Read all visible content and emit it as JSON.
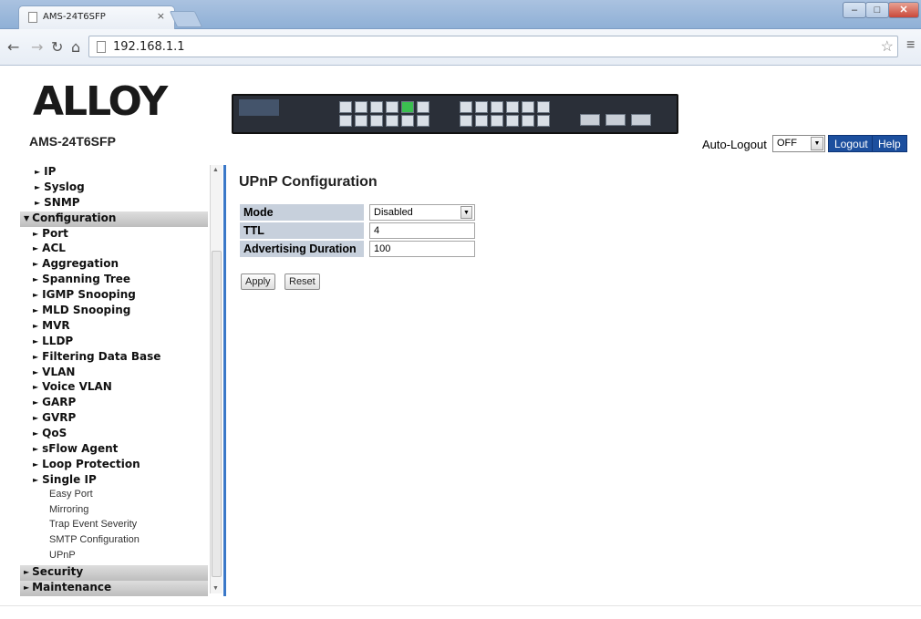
{
  "browser": {
    "tab_title": "AMS-24T6SFP",
    "tab_close": "×",
    "url": "192.168.1.1"
  },
  "header": {
    "logo_text": "ALLOY",
    "model": "AMS-24T6SFP",
    "switch_badge": "ALLOY",
    "auto_logout_label": "Auto-Logout",
    "auto_logout_value": "OFF",
    "logout_label": "Logout",
    "help_label": "Help"
  },
  "nav": {
    "items": [
      {
        "label": "IP",
        "level": "l1"
      },
      {
        "label": "Syslog",
        "level": "l1"
      },
      {
        "label": "SNMP",
        "level": "l1"
      },
      {
        "label": "Configuration",
        "level": "section",
        "expanded": true
      },
      {
        "label": "Port",
        "level": "l2"
      },
      {
        "label": "ACL",
        "level": "l2"
      },
      {
        "label": "Aggregation",
        "level": "l2"
      },
      {
        "label": "Spanning Tree",
        "level": "l2"
      },
      {
        "label": "IGMP Snooping",
        "level": "l2"
      },
      {
        "label": "MLD Snooping",
        "level": "l2"
      },
      {
        "label": "MVR",
        "level": "l2"
      },
      {
        "label": "LLDP",
        "level": "l2"
      },
      {
        "label": "Filtering Data Base",
        "level": "l2"
      },
      {
        "label": "VLAN",
        "level": "l2"
      },
      {
        "label": "Voice VLAN",
        "level": "l2"
      },
      {
        "label": "GARP",
        "level": "l2"
      },
      {
        "label": "GVRP",
        "level": "l2"
      },
      {
        "label": "QoS",
        "level": "l2"
      },
      {
        "label": "sFlow Agent",
        "level": "l2"
      },
      {
        "label": "Loop Protection",
        "level": "l2"
      },
      {
        "label": "Single IP",
        "level": "l2"
      },
      {
        "label": "Easy Port",
        "level": "l3"
      },
      {
        "label": "Mirroring",
        "level": "l3"
      },
      {
        "label": "Trap Event Severity",
        "level": "l3"
      },
      {
        "label": "SMTP Configuration",
        "level": "l3"
      },
      {
        "label": "UPnP",
        "level": "l3"
      },
      {
        "label": "Security",
        "level": "section",
        "expanded": false
      },
      {
        "label": "Maintenance",
        "level": "section",
        "expanded": false
      }
    ]
  },
  "main": {
    "title": "UPnP Configuration",
    "rows": [
      {
        "param": "Mode",
        "value": "Disabled",
        "type": "select"
      },
      {
        "param": "TTL",
        "value": "4",
        "type": "input"
      },
      {
        "param": "Advertising Duration",
        "value": "100",
        "type": "input"
      }
    ],
    "apply_label": "Apply",
    "reset_label": "Reset"
  },
  "colors": {
    "accent": "#1c4f9e",
    "divider": "#3a78c8",
    "param_bg": "#c7d0dc"
  }
}
